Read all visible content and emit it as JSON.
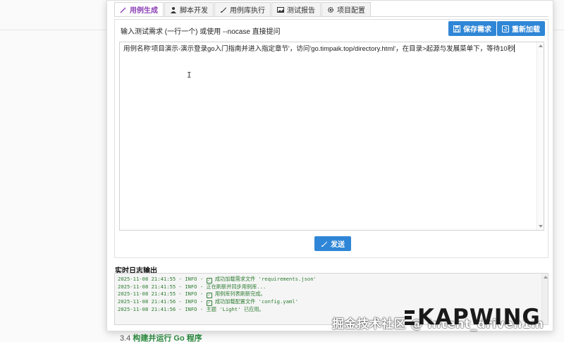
{
  "tabs": [
    {
      "label": "用例生成",
      "icon": "magic-wand-icon",
      "active": true
    },
    {
      "label": "脚本开发",
      "icon": "user-icon",
      "active": false
    },
    {
      "label": "用例库执行",
      "icon": "rocket-icon",
      "active": false
    },
    {
      "label": "测试报告",
      "icon": "image-icon",
      "active": false
    },
    {
      "label": "项目配置",
      "icon": "gear-icon",
      "active": false
    }
  ],
  "panel": {
    "prompt_label": "输入测试需求 (一行一个) 或使用 --nocase 直接提问",
    "save_label": "保存需求",
    "reload_label": "重新加载",
    "textarea_value": "用例名称'项目演示-演示登录go入门指南并进入指定章节'，访问'go.timpaik.top/directory.html'，在目录>起源与发展菜单下，等待10秒",
    "send_label": "发送"
  },
  "log": {
    "title": "实时日志输出",
    "lines": [
      {
        "prefix": "2025-11-08 21:41:55 - INFO - ",
        "check": true,
        "text": " 成功加载需求文件 'requirements.json'"
      },
      {
        "prefix": "2025-11-08 21:41:55 - INFO - ",
        "check": false,
        "text": "正在刷新并同步用例库..."
      },
      {
        "prefix": "2025-11-08 21:41:55 - INFO - ",
        "check": true,
        "text": " 用例库列表刷新完成。"
      },
      {
        "prefix": "2025-11-08 21:41:56 - INFO - ",
        "check": true,
        "text": " 成功加载配置文件 'config.yaml'"
      },
      {
        "prefix": "2025-11-08 21:41:56 - INFO - ",
        "check": false,
        "text": "主题 'Light' 已应用。"
      }
    ]
  },
  "background": {
    "item_number": "3.4",
    "item_text": "构建并运行 Go 程序"
  },
  "watermark": {
    "cn_text": "掘金技术社区 @ Intent_driven1m",
    "brand": "KAPWING"
  },
  "colors": {
    "accent_blue": "#2f86d6",
    "active_tab": "#8b3fb5",
    "log_green": "#2e7d32"
  }
}
